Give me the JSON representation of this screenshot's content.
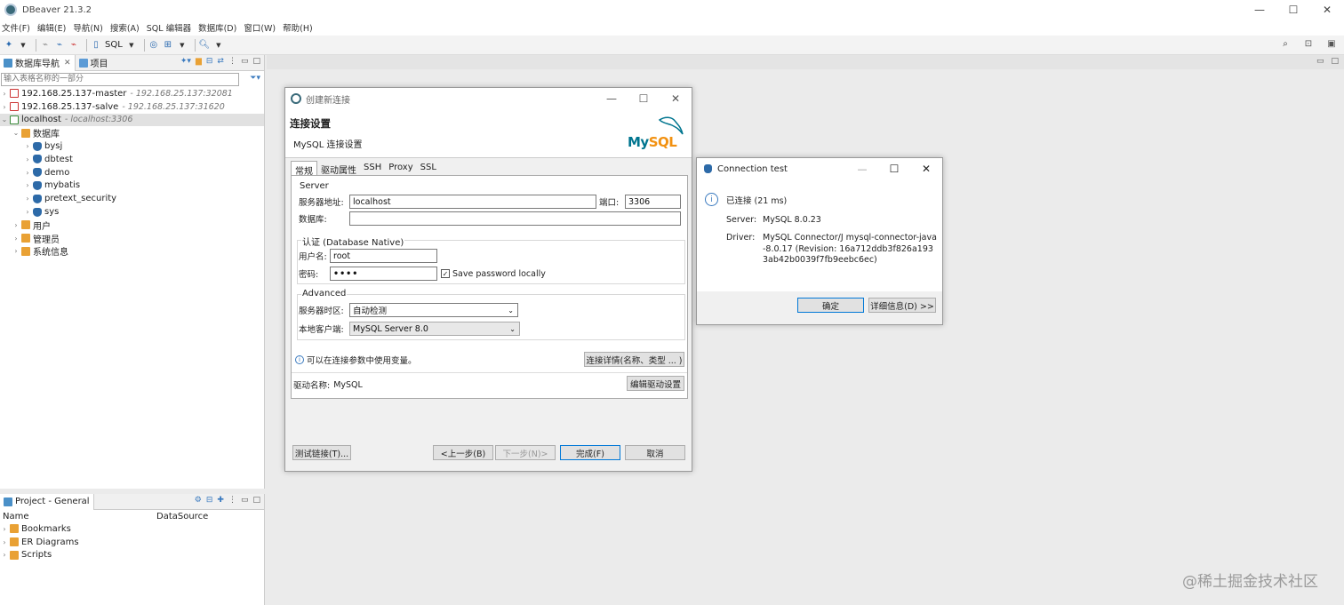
{
  "app": {
    "title": "DBeaver 21.3.2",
    "window_buttons": [
      "—",
      "☐",
      "✕"
    ]
  },
  "menu": [
    "文件(F)",
    "编辑(E)",
    "导航(N)",
    "搜索(A)",
    "SQL 编辑器",
    "数据库(D)",
    "窗口(W)",
    "帮助(H)"
  ],
  "toolbar": {
    "sql_label": "SQL"
  },
  "navigator": {
    "tab_db": "数据库导航",
    "tab_project": "项目",
    "filter_placeholder": "输入表格名称的一部分",
    "connections": [
      {
        "name": "192.168.25.137-master",
        "host": "- 192.168.25.137:32081"
      },
      {
        "name": "192.168.25.137-salve",
        "host": "- 192.168.25.137:31620"
      },
      {
        "name": "localhost",
        "host": "- localhost:3306"
      }
    ],
    "databases_label": "数据库",
    "databases": [
      "bysj",
      "dbtest",
      "demo",
      "mybatis",
      "pretext_security",
      "sys"
    ],
    "folders": [
      "用户",
      "管理员",
      "系统信息"
    ]
  },
  "project": {
    "tab": "Project - General",
    "col_name": "Name",
    "col_datasource": "DataSource",
    "items": [
      "Bookmarks",
      "ER Diagrams",
      "Scripts"
    ]
  },
  "conn_dialog": {
    "title": "创建新连接",
    "header_title": "连接设置",
    "header_sub": "MySQL 连接设置",
    "logo_my": "My",
    "logo_sql": "SQL",
    "tabs": [
      "常规",
      "驱动属性",
      "SSH",
      "Proxy",
      "SSL"
    ],
    "server_group": "Server",
    "host_label": "服务器地址:",
    "host_value": "localhost",
    "port_label": "端口:",
    "port_value": "3306",
    "db_label": "数据库:",
    "db_value": "",
    "auth_group": "认证 (Database Native)",
    "user_label": "用户名:",
    "user_value": "root",
    "pwd_label": "密码:",
    "pwd_value": "••••",
    "save_pwd": "Save password locally",
    "save_pwd_checked": "✓",
    "advanced_group": "Advanced",
    "tz_label": "服务器时区:",
    "tz_value": "自动检测",
    "client_label": "本地客户端:",
    "client_value": "MySQL Server 8.0",
    "vars_hint": "可以在连接参数中使用变量。",
    "conn_details_btn": "连接详情(名称、类型 ... )",
    "driver_label": "驱动名称:",
    "driver_value": "MySQL",
    "edit_driver_btn": "编辑驱动设置",
    "test_btn": "测试链接(T)...",
    "back_btn": "<上一步(B)",
    "next_btn": "下一步(N)>",
    "finish_btn": "完成(F)",
    "cancel_btn": "取消"
  },
  "test_dialog": {
    "title": "Connection test",
    "status": "已连接 (21 ms)",
    "server_key": "Server:",
    "server_value": "MySQL 8.0.23",
    "driver_key": "Driver:",
    "driver_value": "MySQL Connector/J mysql-connector-java-8.0.17 (Revision: 16a712ddb3f826a1933ab42b0039f7fb9eebc6ec)",
    "ok_btn": "确定",
    "details_btn": "详细信息(D) >>"
  },
  "watermark": "@稀土掘金技术社区",
  "colors": {
    "accent": "#0078d7",
    "mysql_orange": "#f29111",
    "mysql_blue": "#00758f"
  }
}
